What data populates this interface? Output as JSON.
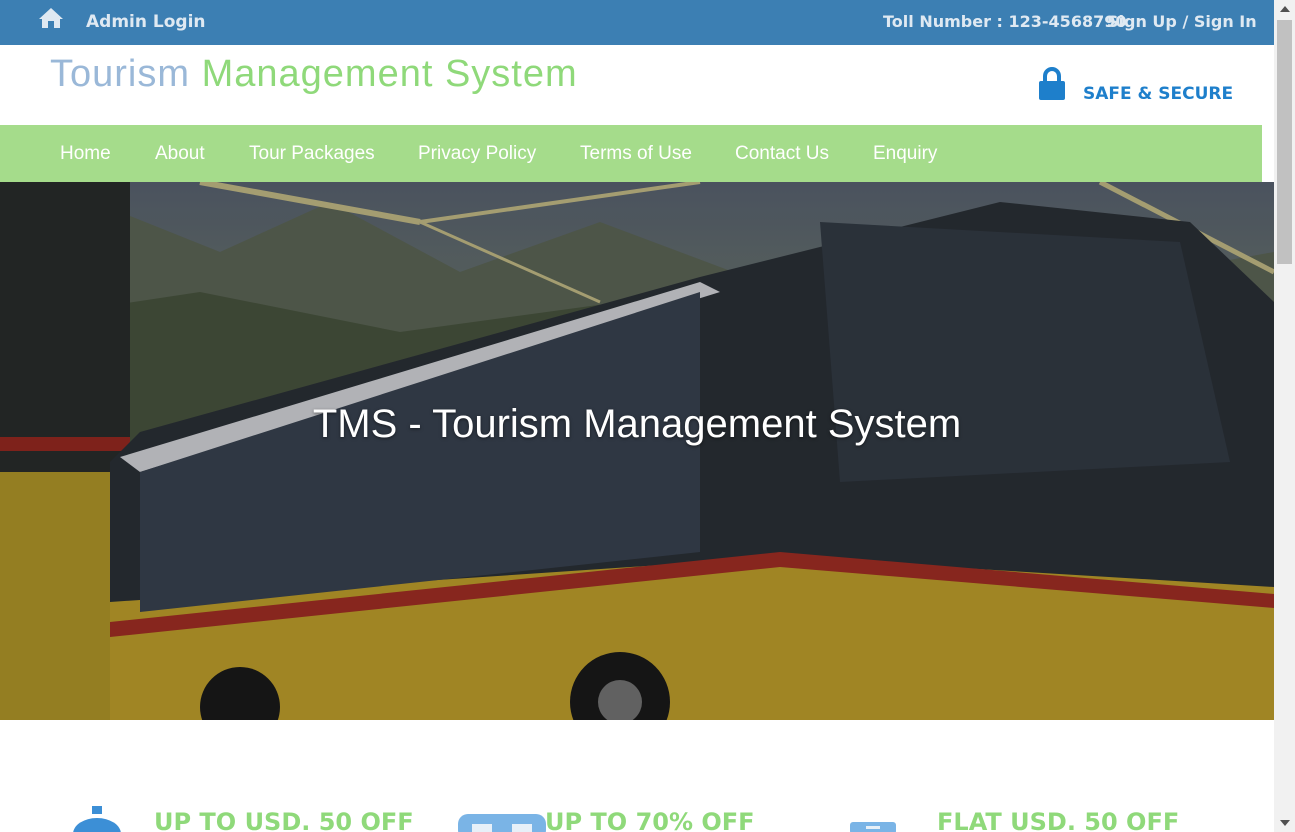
{
  "topbar": {
    "home_icon": "home-icon",
    "admin_login": "Admin Login",
    "toll_number": "Toll Number : 123-4568790",
    "sign_up_in": "Sign Up / Sign In"
  },
  "header": {
    "brand_word1": "Tourism",
    "brand_word2": "Management System",
    "lock_icon": "lock-icon",
    "secure_label": "SAFE & SECURE"
  },
  "nav": {
    "items": [
      {
        "label": "Home"
      },
      {
        "label": "About"
      },
      {
        "label": "Tour Packages"
      },
      {
        "label": "Privacy Policy"
      },
      {
        "label": "Terms of Use"
      },
      {
        "label": "Contact Us"
      },
      {
        "label": "Enquiry"
      }
    ]
  },
  "hero": {
    "title": "TMS - Tourism Management System"
  },
  "offers": [
    {
      "label": "UP TO USD. 50 OFF"
    },
    {
      "label": "UP TO 70% OFF"
    },
    {
      "label": "FLAT USD. 50 OFF"
    }
  ],
  "colors": {
    "topbar": "#3c7fb3",
    "nav": "#a5dc8b",
    "accent_green": "#8fd97a",
    "accent_blue": "#1e7fcb"
  }
}
